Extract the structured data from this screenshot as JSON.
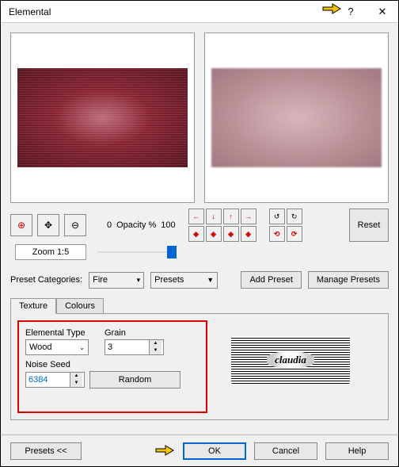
{
  "window": {
    "title": "Elemental"
  },
  "zoom": {
    "value_label": "Zoom 1:5"
  },
  "opacity": {
    "min_label": "0",
    "label": "Opacity %",
    "value": "100"
  },
  "reset_label": "Reset",
  "preset_row": {
    "label": "Preset Categories:",
    "category_value": "Fire",
    "presets_label": "Presets",
    "add_label": "Add Preset",
    "manage_label": "Manage Presets"
  },
  "tabs": {
    "texture": "Texture",
    "colours": "Colours"
  },
  "texture_panel": {
    "elemental_type_label": "Elemental Type",
    "elemental_type_value": "Wood",
    "grain_label": "Grain",
    "grain_value": "3",
    "noise_seed_label": "Noise Seed",
    "noise_seed_value": "6384",
    "random_label": "Random"
  },
  "logo_text": "claudia",
  "footer": {
    "presets_label": "Presets  <<",
    "ok_label": "OK",
    "cancel_label": "Cancel",
    "help_label": "Help"
  }
}
